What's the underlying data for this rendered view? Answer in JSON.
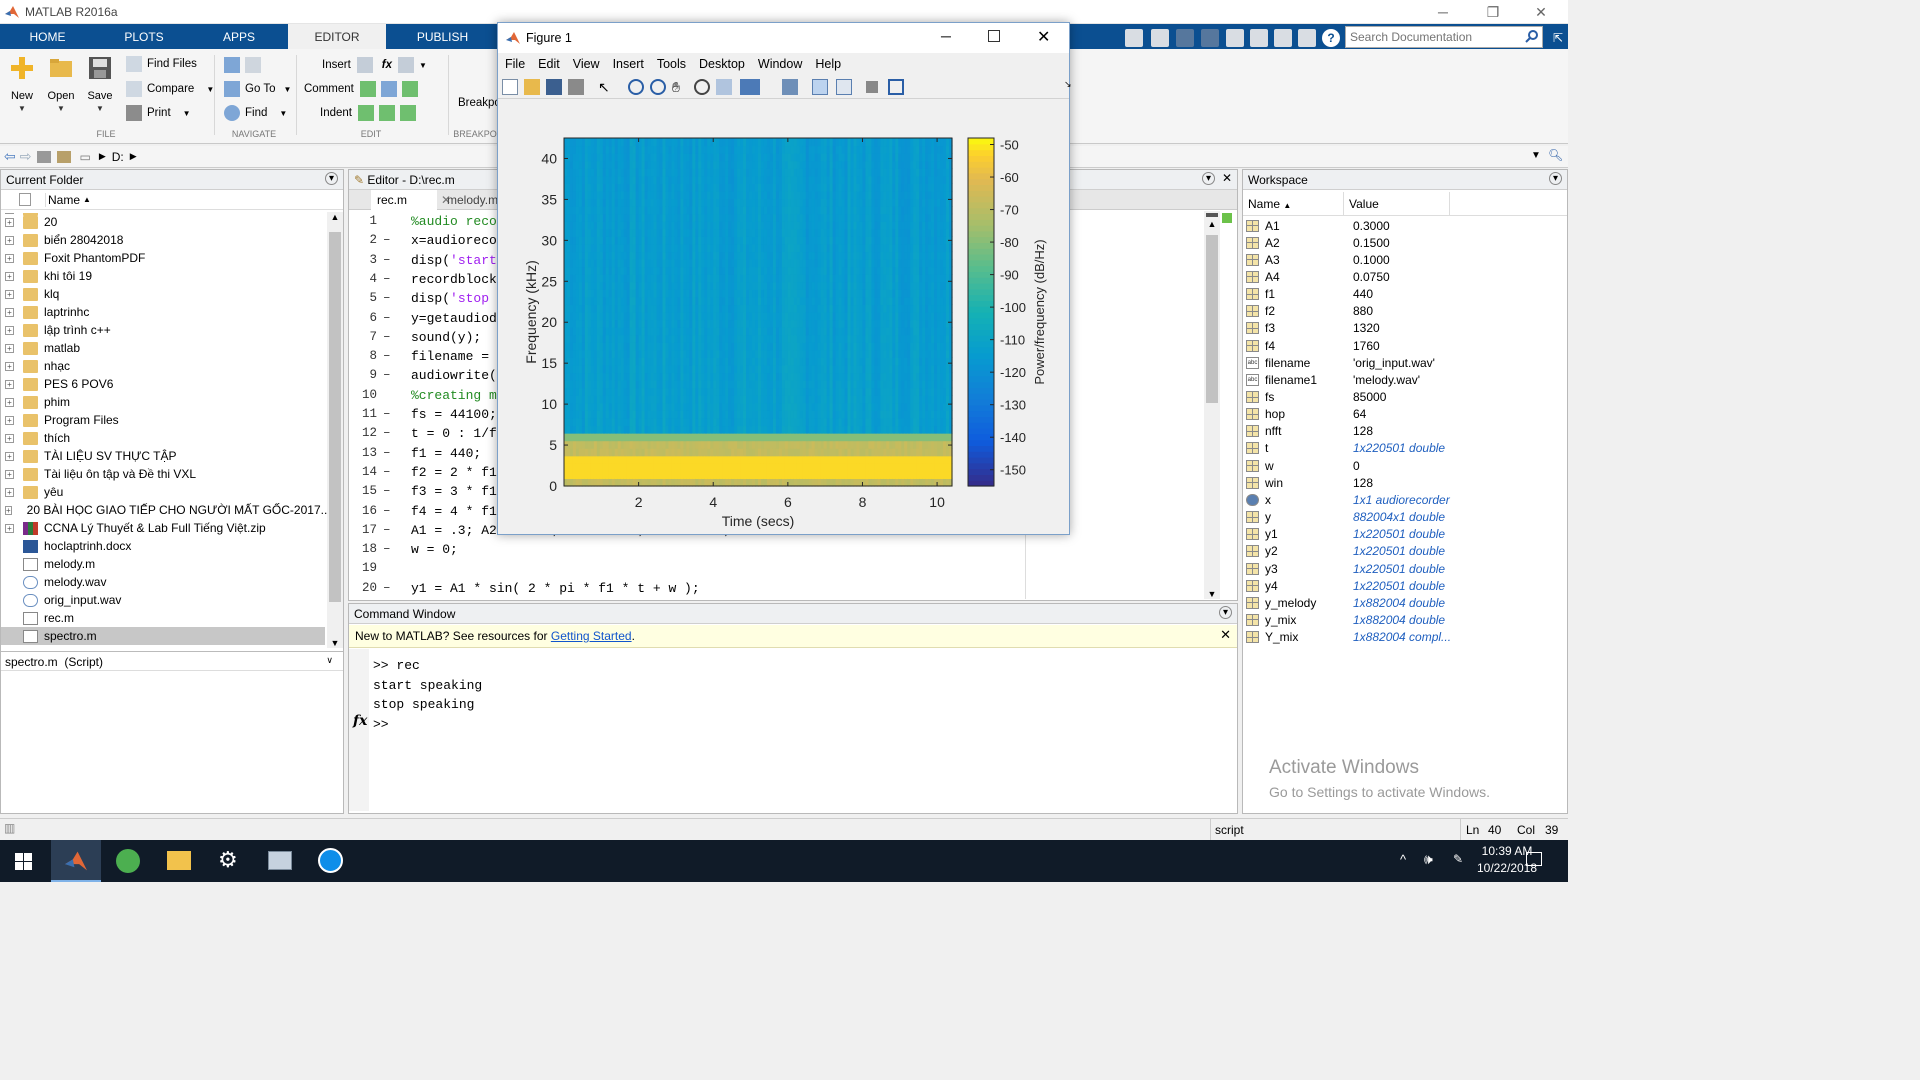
{
  "app": {
    "title": "MATLAB R2016a",
    "tabs": [
      "HOME",
      "PLOTS",
      "APPS",
      "EDITOR",
      "PUBLISH"
    ],
    "active_tab": "EDITOR",
    "search_placeholder": "Search Documentation"
  },
  "ribbon": {
    "new": "New",
    "open": "Open",
    "save": "Save",
    "find_files": "Find Files",
    "compare": "Compare",
    "print": "Print",
    "go_to": "Go To",
    "find": "Find",
    "insert": "Insert",
    "comment": "Comment",
    "indent": "Indent",
    "fx": "fx",
    "breakpoints": "Breakpo",
    "sections": {
      "file": "FILE",
      "navigate": "NAVIGATE",
      "edit": "EDIT",
      "breakpoints": "BREAKPO"
    }
  },
  "address": {
    "path": "D:"
  },
  "current_folder": {
    "title": "Current Folder",
    "column": "Name",
    "items": [
      {
        "name": "20",
        "type": "folder"
      },
      {
        "name": "biển 28042018",
        "type": "folder"
      },
      {
        "name": "Foxit PhantomPDF",
        "type": "folder"
      },
      {
        "name": "khi tôi 19",
        "type": "folder"
      },
      {
        "name": "klq",
        "type": "folder"
      },
      {
        "name": "laptrinhc",
        "type": "folder"
      },
      {
        "name": "lập trình c++",
        "type": "folder"
      },
      {
        "name": "matlab",
        "type": "folder"
      },
      {
        "name": "nhạc",
        "type": "folder"
      },
      {
        "name": "PES 6 POV6",
        "type": "folder"
      },
      {
        "name": "phim",
        "type": "folder"
      },
      {
        "name": "Program Files",
        "type": "folder"
      },
      {
        "name": "thích",
        "type": "folder"
      },
      {
        "name": "TÀI LIỆU SV THỰC TẬP",
        "type": "folder"
      },
      {
        "name": "Tài liệu ôn tập và Đề thi VXL",
        "type": "folder"
      },
      {
        "name": "yêu",
        "type": "folder"
      },
      {
        "name": "20 BÀI HỌC GIAO TIẾP CHO NGƯỜI MẤT GỐC-2017...",
        "type": "zip"
      },
      {
        "name": "CCNA Lý Thuyết & Lab Full Tiếng Việt.zip",
        "type": "zip"
      },
      {
        "name": "hoclaptrinh.docx",
        "type": "doc"
      },
      {
        "name": "melody.m",
        "type": "mfile"
      },
      {
        "name": "melody.wav",
        "type": "wav"
      },
      {
        "name": "orig_input.wav",
        "type": "wav"
      },
      {
        "name": "rec.m",
        "type": "mfile"
      },
      {
        "name": "spectro.m",
        "type": "mfile",
        "selected": true
      }
    ],
    "details": "spectro.m  (Script)"
  },
  "editor": {
    "title": "Editor - D:\\rec.m",
    "tabs": [
      "rec.m",
      "melody.m"
    ],
    "lines": [
      {
        "n": "1",
        "dash": "",
        "code": "%audio reco",
        "cls": "cmt"
      },
      {
        "n": "2",
        "dash": "–",
        "code": "x=audioreco",
        "cls": ""
      },
      {
        "n": "3",
        "dash": "–",
        "code": "disp('start",
        "cls": "strline"
      },
      {
        "n": "4",
        "dash": "–",
        "code": "recordblock",
        "cls": ""
      },
      {
        "n": "5",
        "dash": "–",
        "code": "disp('stop",
        "cls": "strline"
      },
      {
        "n": "6",
        "dash": "–",
        "code": "y=getaudiod",
        "cls": ""
      },
      {
        "n": "7",
        "dash": "–",
        "code": "sound(y);",
        "cls": ""
      },
      {
        "n": "8",
        "dash": "–",
        "code": "filename =",
        "cls": ""
      },
      {
        "n": "9",
        "dash": "–",
        "code": "audiowrite(",
        "cls": ""
      },
      {
        "n": "10",
        "dash": "",
        "code": "%creating m",
        "cls": "cmt"
      },
      {
        "n": "11",
        "dash": "–",
        "code": "fs = 44100;",
        "cls": ""
      },
      {
        "n": "12",
        "dash": "–",
        "code": "t = 0 : 1/f",
        "cls": ""
      },
      {
        "n": "13",
        "dash": "–",
        "code": "f1 = 440;",
        "cls": ""
      },
      {
        "n": "14",
        "dash": "–",
        "code": "f2 = 2 * f1",
        "cls": ""
      },
      {
        "n": "15",
        "dash": "–",
        "code": "f3 = 3 * f1",
        "cls": ""
      },
      {
        "n": "16",
        "dash": "–",
        "code": "f4 = 4 * f1",
        "cls": ""
      },
      {
        "n": "17",
        "dash": "–",
        "code": "A1 = .3; A2 = A1/2; A3 = A1/3; A4 = A1/4;",
        "cls": ""
      },
      {
        "n": "18",
        "dash": "–",
        "code": "w = 0;",
        "cls": ""
      },
      {
        "n": "19",
        "dash": "",
        "code": "",
        "cls": ""
      },
      {
        "n": "20",
        "dash": "–",
        "code": "y1 = A1 * sin( 2 * pi * f1 * t + w );",
        "cls": ""
      }
    ]
  },
  "command_window": {
    "title": "Command Window",
    "banner_text": "New to MATLAB? See resources for ",
    "banner_link": "Getting Started",
    "banner_end": ".",
    "lines": [
      ">> rec",
      "start speaking",
      "stop speaking"
    ],
    "prompt": ">>",
    "fx": "fx"
  },
  "workspace": {
    "title": "Workspace",
    "col_name": "Name",
    "col_value": "Value",
    "vars": [
      {
        "name": "A1",
        "value": "0.3000",
        "italic": false,
        "icon": "grid"
      },
      {
        "name": "A2",
        "value": "0.1500",
        "italic": false,
        "icon": "grid"
      },
      {
        "name": "A3",
        "value": "0.1000",
        "italic": false,
        "icon": "grid"
      },
      {
        "name": "A4",
        "value": "0.0750",
        "italic": false,
        "icon": "grid"
      },
      {
        "name": "f1",
        "value": "440",
        "italic": false,
        "icon": "grid"
      },
      {
        "name": "f2",
        "value": "880",
        "italic": false,
        "icon": "grid"
      },
      {
        "name": "f3",
        "value": "1320",
        "italic": false,
        "icon": "grid"
      },
      {
        "name": "f4",
        "value": "1760",
        "italic": false,
        "icon": "grid"
      },
      {
        "name": "filename",
        "value": "'orig_input.wav'",
        "italic": false,
        "icon": "abc"
      },
      {
        "name": "filename1",
        "value": "'melody.wav'",
        "italic": false,
        "icon": "abc"
      },
      {
        "name": "fs",
        "value": "85000",
        "italic": false,
        "icon": "grid"
      },
      {
        "name": "hop",
        "value": "64",
        "italic": false,
        "icon": "grid"
      },
      {
        "name": "nfft",
        "value": "128",
        "italic": false,
        "icon": "grid"
      },
      {
        "name": "t",
        "value": "1x220501 double",
        "italic": true,
        "icon": "grid"
      },
      {
        "name": "w",
        "value": "0",
        "italic": false,
        "icon": "grid"
      },
      {
        "name": "win",
        "value": "128",
        "italic": false,
        "icon": "grid"
      },
      {
        "name": "x",
        "value": "1x1 audiorecorder",
        "italic": true,
        "icon": "obj"
      },
      {
        "name": "y",
        "value": "882004x1 double",
        "italic": true,
        "icon": "grid"
      },
      {
        "name": "y1",
        "value": "1x220501 double",
        "italic": true,
        "icon": "grid"
      },
      {
        "name": "y2",
        "value": "1x220501 double",
        "italic": true,
        "icon": "grid"
      },
      {
        "name": "y3",
        "value": "1x220501 double",
        "italic": true,
        "icon": "grid"
      },
      {
        "name": "y4",
        "value": "1x220501 double",
        "italic": true,
        "icon": "grid"
      },
      {
        "name": "y_melody",
        "value": "1x882004 double",
        "italic": true,
        "icon": "grid"
      },
      {
        "name": "y_mix",
        "value": "1x882004 double",
        "italic": true,
        "icon": "grid"
      },
      {
        "name": "Y_mix",
        "value": "1x882004 compl...",
        "italic": true,
        "icon": "grid"
      }
    ],
    "watermark_title": "Activate Windows",
    "watermark_sub": "Go to Settings to activate Windows."
  },
  "figure": {
    "title": "Figure 1",
    "menu": [
      "File",
      "Edit",
      "View",
      "Insert",
      "Tools",
      "Desktop",
      "Window",
      "Help"
    ]
  },
  "chart_data": {
    "type": "heatmap",
    "xlabel": "Time (secs)",
    "ylabel": "Frequency (kHz)",
    "colorbar_label": "Power/frequency (dB/Hz)",
    "xlim": [
      0,
      10.4
    ],
    "ylim": [
      0,
      42.5
    ],
    "xticks": [
      2,
      4,
      6,
      8,
      10
    ],
    "yticks": [
      0,
      5,
      10,
      15,
      20,
      25,
      30,
      35,
      40
    ],
    "clim": [
      -155,
      -48
    ],
    "cticks": [
      -50,
      -60,
      -70,
      -80,
      -90,
      -100,
      -110,
      -120,
      -130,
      -140,
      -150
    ],
    "colormap": "parula",
    "segments": [
      {
        "t_start": 0,
        "t_end": 2.6,
        "tone_khz": 0.44,
        "band_top_khz": 2.2,
        "background_db": -95
      },
      {
        "t_start": 2.6,
        "t_end": 5.2,
        "tone_khz": 0.88,
        "band_top_khz": 3.1,
        "background_db": -100
      },
      {
        "t_start": 5.2,
        "t_end": 7.8,
        "tone_khz": 1.32,
        "band_top_khz": 4.0,
        "background_db": -106
      },
      {
        "t_start": 7.8,
        "t_end": 10.4,
        "tone_khz": 1.76,
        "band_top_khz": 5.1,
        "background_db": -112
      }
    ]
  },
  "statusbar": {
    "mode": "script",
    "ln_label": "Ln",
    "ln": "40",
    "col_label": "Col",
    "col": "39"
  },
  "taskbar": {
    "time": "10:39 AM",
    "date": "10/22/2018"
  },
  "colors": {
    "accent": "#0b4f91",
    "taskbar": "#101b28",
    "selected_row": "#c7c7c7",
    "banner": "#ffffe1"
  }
}
